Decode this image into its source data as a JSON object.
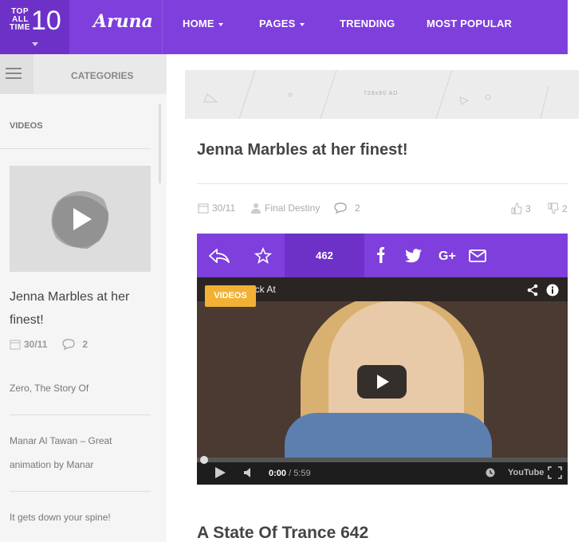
{
  "badge": {
    "small": "TOP ALL TIME",
    "big": "10"
  },
  "logo": "Aruna",
  "nav": {
    "home": "HOME",
    "pages": "PAGES",
    "trending": "TRENDING",
    "popular": "MOST POPULAR"
  },
  "sidebar": {
    "categories_label": "CATEGORIES",
    "videos_label": "VIDEOS",
    "featured_title": "Jenna Marbles at her finest!",
    "featured_date": "30/11",
    "featured_comments": "2",
    "links": [
      "Zero, The Story Of",
      "Manar Al Tawan – Great animation by Manar",
      "It gets down your spine!"
    ]
  },
  "ad": {
    "text": "728x90 AD"
  },
  "post": {
    "title": "Jenna Marbles at her finest!",
    "date": "30/11",
    "author": "Final Destiny",
    "comments": "2",
    "likes": "3",
    "dislikes": "2",
    "share_count": "462"
  },
  "video": {
    "badge": "VIDEOS",
    "title": "uck At",
    "time_current": "0:00",
    "time_total": "/ 5:59",
    "yt": "YouTube"
  },
  "next_post": {
    "title": "A State Of Trance 642"
  },
  "colors": {
    "accent": "#7e3fdc",
    "accent_dark": "#6d31c8",
    "badge": "#f2b134"
  }
}
